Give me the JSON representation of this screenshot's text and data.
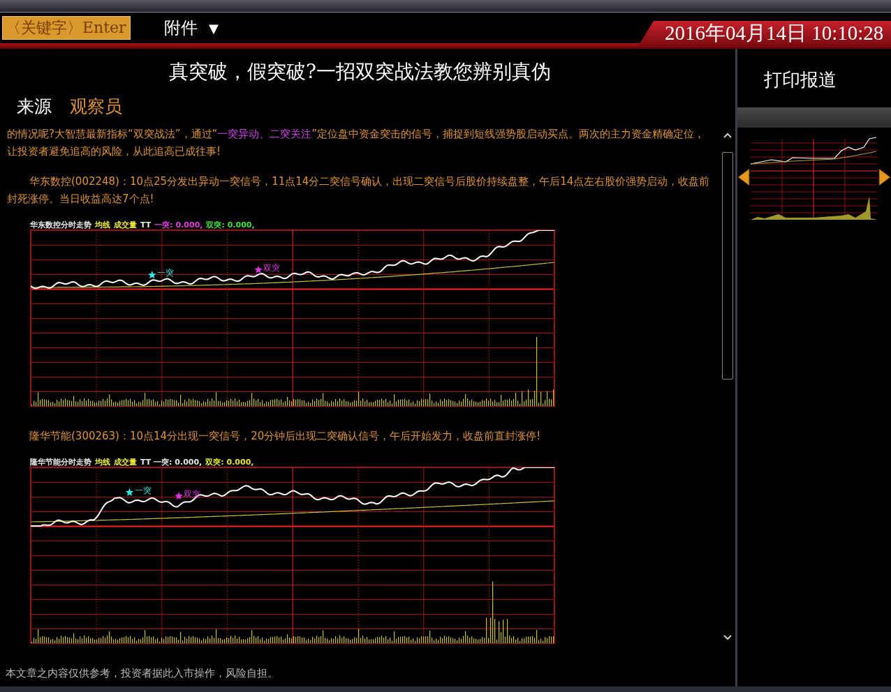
{
  "toolbar": {
    "search": {
      "value": "〈关键字〉Enter"
    },
    "attachment_menu": {
      "label": "附件",
      "arrow": "▼"
    },
    "datetime": "2016年04月14日 10:10:28"
  },
  "article": {
    "title": "真突破，假突破?一招双突战法教您辨别真伪",
    "source_label": "来源",
    "source": "观察员",
    "blocks": [
      {
        "kind": "paragraph",
        "indent": false,
        "segments": [
          {
            "text": "的情况呢?大智慧最新指标“双突战法”，通过“",
            "highlight": false
          },
          {
            "text": "一突异动、二突关注",
            "highlight": true
          },
          {
            "text": "”定位盘中资金突击的信号，捕捉到短线强势股启动买点。两次的主力资金精确定位，让投资者避免追高的风险，从此追高已成往事!",
            "highlight": false
          }
        ]
      },
      {
        "kind": "paragraph",
        "indent": true,
        "segments": [
          {
            "text": "华东数控(002248)：10点25分发出异动一突信号，11点14分二突信号确认，出现二突信号后股价持续盘整，午后14点左右股价强势启动，收盘前封死涨停。当日收益高达7个点!",
            "highlight": false
          }
        ]
      },
      {
        "kind": "chart",
        "legend": [
          {
            "text": "华东数控分时走势",
            "color": "#e8e8e8"
          },
          {
            "text": "均线",
            "color": "#e8e830"
          },
          {
            "text": "成交量",
            "color": "#e8e830"
          },
          {
            "text": "TT",
            "color": "#e8e8e8"
          },
          {
            "text": "一突: 0.000,",
            "color": "#e040e0"
          },
          {
            "text": "双突: 0.000,",
            "color": "#40e040"
          }
        ],
        "markers": [
          {
            "label": "一突",
            "color": "#30e8e8"
          },
          {
            "label": "双突",
            "color": "#e030e0"
          }
        ]
      },
      {
        "kind": "paragraph",
        "indent": true,
        "segments": [
          {
            "text": "隆华节能(300263)：10点14分出现一突信号，20分钟后出现二突确认信号，午后开始发力，收盘前直封涨停!",
            "highlight": false
          }
        ]
      },
      {
        "kind": "chart",
        "legend": [
          {
            "text": "隆华节能分时走势",
            "color": "#e8e8e8"
          },
          {
            "text": "均线",
            "color": "#e8e830"
          },
          {
            "text": "成交量",
            "color": "#e8e830"
          },
          {
            "text": "TT 一突: 0.000,",
            "color": "#e8e8e8"
          },
          {
            "text": "双突: 0.000,",
            "color": "#e8e830"
          }
        ],
        "markers": [
          {
            "label": "一突",
            "color": "#30e8e8"
          },
          {
            "label": "双突",
            "color": "#e030e0"
          }
        ]
      }
    ],
    "disclaimer": "本文章之内容仅供参考，投资者据此入市操作，风险自担。"
  },
  "side_panel": {
    "print_button": "打印报道"
  }
}
